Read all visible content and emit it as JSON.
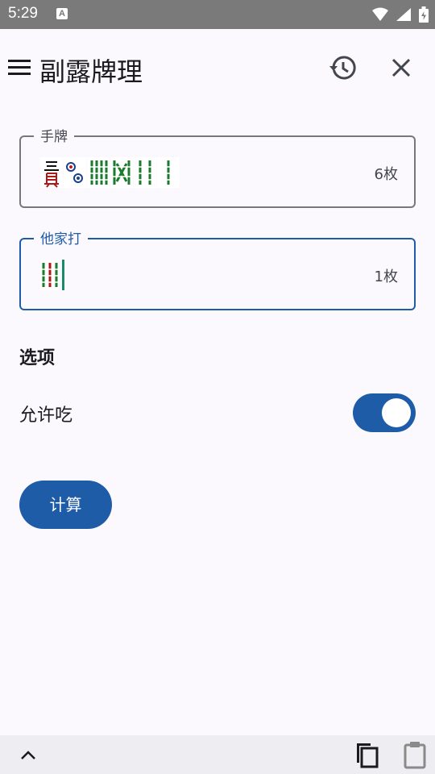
{
  "status": {
    "time": "5:29",
    "keyboard_badge": "A"
  },
  "app": {
    "title": "副露牌理"
  },
  "hand": {
    "label": "手牌",
    "count": "6枚"
  },
  "discard": {
    "label": "他家打",
    "count": "1枚"
  },
  "options": {
    "section_title": "选项",
    "allow_chi_label": "允许吃",
    "allow_chi_enabled": true
  },
  "actions": {
    "calculate_label": "计算"
  },
  "colors": {
    "primary": "#1f5ca8",
    "surface": "#fbf9fd",
    "statusbar": "#7a7a7a"
  },
  "icons": {
    "menu": "menu-icon",
    "history": "history-icon",
    "close": "close-icon",
    "chevron": "chevron-up-icon",
    "copy": "copy-icon",
    "paste": "clipboard-icon"
  }
}
